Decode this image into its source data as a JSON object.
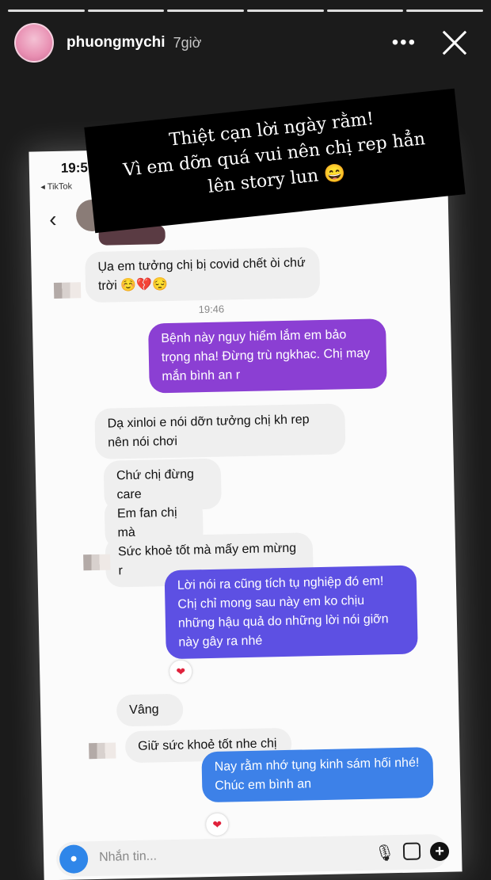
{
  "story": {
    "username": "phuongmychi",
    "time_ago": "7giờ",
    "more_label": "•••"
  },
  "caption": {
    "line1": "Thiệt cạn lời ngày rằm!",
    "line2": "Vì em dỡn quá vui nên chị rep hẳn",
    "line3": "lên story lun 😄"
  },
  "screenshot": {
    "status_time": "19:5",
    "back_app": "◂ TikTok",
    "timestamp": "19:46",
    "composer_placeholder": "Nhắn tin..."
  },
  "messages": [
    {
      "side": "in",
      "text": "Ụa em tưởng chị bị covid chết òi chứ trời ☺️💔😔"
    },
    {
      "side": "out",
      "text": "Bệnh này nguy hiểm lắm em bảo trọng nha! Đừng trù ngkhac. Chị may mắn bình an r"
    },
    {
      "side": "in",
      "text": "Dạ xinloi e nói dỡn tưởng chị kh rep nên nói chơi"
    },
    {
      "side": "in",
      "text": "Chứ chị đừng care"
    },
    {
      "side": "in",
      "text": "Em fan chị mà"
    },
    {
      "side": "in",
      "text": "Sức khoẻ tốt mà mấy em mừng r"
    },
    {
      "side": "out",
      "text": "Lời nói ra cũng tích tụ nghiệp đó em! Chị chỉ mong sau này em ko chịu những hậu quả do những lời nói giỡn này gây ra nhé"
    },
    {
      "side": "in",
      "text": "Vâng"
    },
    {
      "side": "in",
      "text": "Giữ sức khoẻ tốt nhe chị"
    },
    {
      "side": "out",
      "text": "Nay rằm nhớ tụng kinh sám hối nhé! Chúc em bình an"
    }
  ],
  "reactions": {
    "heart": "❤"
  },
  "colors": {
    "bubble_purple": "#8b3fd3",
    "bubble_indigo": "#5d50e3",
    "bubble_blue": "#3d81e8",
    "bubble_incoming": "#efefef",
    "camera_button": "#2f86e9"
  },
  "icons": [
    "more-icon",
    "close-icon",
    "back-chevron-icon",
    "microphone-icon",
    "image-icon",
    "add-icon",
    "camera-icon",
    "heart-icon"
  ]
}
